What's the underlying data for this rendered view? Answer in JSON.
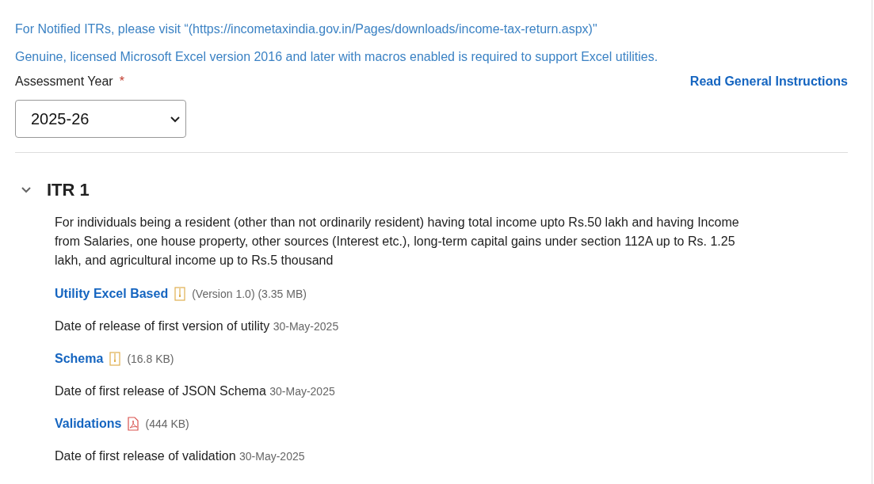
{
  "notices": [
    "For Notified ITRs, please visit “(https://incometaxindia.gov.in/Pages/downloads/income-tax-return.aspx)\"",
    "Genuine, licensed Microsoft Excel version 2016 and later with macros enabled is required to support Excel utilities."
  ],
  "assessment_year": {
    "label": "Assessment Year",
    "required_mark": "*",
    "value": "2025-26"
  },
  "instructions_link": "Read General Instructions",
  "sections": [
    {
      "title": "ITR 1",
      "expanded": true,
      "description": "For individuals being a resident (other than not ordinarily resident) having total income upto Rs.50 lakh and having Income from Salaries, one house property, other sources (Interest etc.), long-term capital gains under section 112A up to Rs. 1.25 lakh, and agricultural income up to Rs.5 thousand",
      "items": [
        {
          "kind": "zip",
          "link": "Utility Excel Based",
          "meta": "(Version 1.0) (3.35 MB)"
        },
        {
          "kind": "date",
          "label": "Date of release of first version of utility",
          "date": "30-May-2025"
        },
        {
          "kind": "zip",
          "link": "Schema",
          "meta": "(16.8 KB)"
        },
        {
          "kind": "date",
          "label": "Date of first release of JSON Schema",
          "date": "30-May-2025"
        },
        {
          "kind": "pdf",
          "link": "Validations",
          "meta": "(444 KB)"
        },
        {
          "kind": "date",
          "label": "Date of first release of validation",
          "date": "30-May-2025"
        }
      ]
    }
  ]
}
